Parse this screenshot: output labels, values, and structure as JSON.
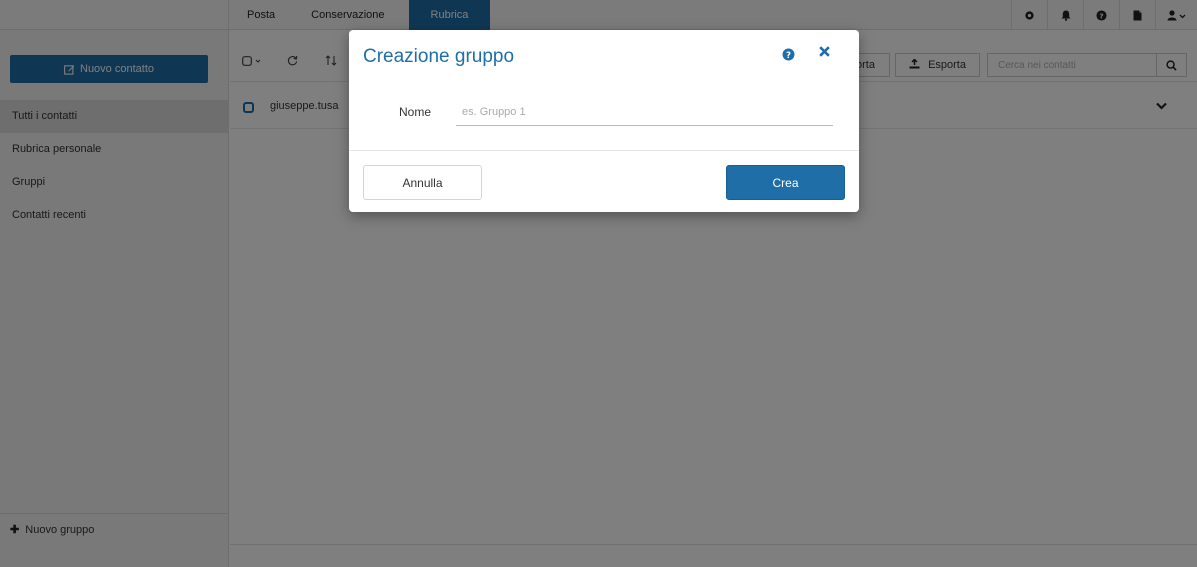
{
  "topbar": {
    "tabs": [
      {
        "label": "Posta"
      },
      {
        "label": "Conservazione"
      },
      {
        "label": "Rubrica"
      }
    ],
    "icons": [
      "settings-icon",
      "bell-icon",
      "help-icon",
      "document-icon",
      "user-icon"
    ]
  },
  "sidebar": {
    "new_contact_label": "Nuovo contatto",
    "items": [
      {
        "label": "Tutti i contatti"
      },
      {
        "label": "Rubrica personale"
      },
      {
        "label": "Gruppi"
      },
      {
        "label": "Contatti recenti"
      }
    ],
    "new_group_label": "Nuovo gruppo"
  },
  "toolbar": {
    "import_label": "orta",
    "export_label": "Esporta",
    "search_placeholder": "Cerca nei contatti"
  },
  "contacts": [
    {
      "email": "giuseppe.tusa"
    }
  ],
  "modal": {
    "title": "Creazione gruppo",
    "name_label": "Nome",
    "name_placeholder": "es. Gruppo 1",
    "cancel_label": "Annulla",
    "create_label": "Crea"
  },
  "colors": {
    "accent": "#1f6ea8",
    "overlay": "#808080",
    "input_error_underline": "#e8a6a6"
  }
}
